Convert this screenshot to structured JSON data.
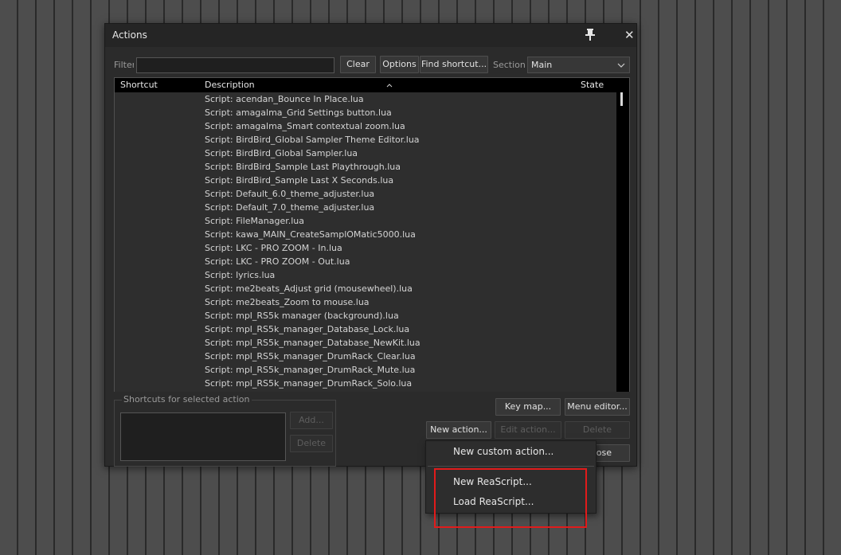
{
  "window": {
    "title": "Actions"
  },
  "filter": {
    "label": "Filter",
    "value": ""
  },
  "toolbar": {
    "clear_label": "Clear",
    "options_label": "Options",
    "find_shortcut_label": "Find shortcut...",
    "section_label": "Section",
    "section_value": "Main"
  },
  "list": {
    "columns": {
      "shortcut": "Shortcut",
      "description": "Description",
      "state": "State"
    },
    "rows": [
      "Script: acendan_Bounce In Place.lua",
      "Script: amagalma_Grid Settings button.lua",
      "Script: amagalma_Smart contextual zoom.lua",
      "Script: BirdBird_Global Sampler Theme Editor.lua",
      "Script: BirdBird_Global Sampler.lua",
      "Script: BirdBird_Sample Last Playthrough.lua",
      "Script: BirdBird_Sample Last X Seconds.lua",
      "Script: Default_6.0_theme_adjuster.lua",
      "Script: Default_7.0_theme_adjuster.lua",
      "Script: FileManager.lua",
      "Script: kawa_MAIN_CreateSamplOMatic5000.lua",
      "Script: LKC - PRO ZOOM - In.lua",
      "Script: LKC - PRO ZOOM - Out.lua",
      "Script: lyrics.lua",
      "Script: me2beats_Adjust grid (mousewheel).lua",
      "Script: me2beats_Zoom to mouse.lua",
      "Script: mpl_RS5k manager (background).lua",
      "Script: mpl_RS5k_manager_Database_Lock.lua",
      "Script: mpl_RS5k_manager_Database_NewKit.lua",
      "Script: mpl_RS5k_manager_DrumRack_Clear.lua",
      "Script: mpl_RS5k_manager_DrumRack_Mute.lua",
      "Script: mpl_RS5k_manager_DrumRack_Solo.lua"
    ]
  },
  "shortcuts_panel": {
    "title": "Shortcuts for selected action",
    "add_label": "Add...",
    "delete_label": "Delete"
  },
  "buttons": {
    "key_map": "Key map...",
    "menu_editor": "Menu editor...",
    "new_action": "New action...",
    "edit_action": "Edit action...",
    "delete": "Delete",
    "close_partial": "ose"
  },
  "menu": {
    "items": [
      "New custom action...",
      "New ReaScript...",
      "Load ReaScript..."
    ]
  },
  "icons": {
    "pin": "pin-icon",
    "close": "close-icon",
    "dropdown": "chevron-down-icon",
    "sort": "sort-caret-icon"
  },
  "colors": {
    "highlight": "#e11b1b",
    "window_bg": "#2b2b2b",
    "list_bg": "#2e2e2e"
  }
}
